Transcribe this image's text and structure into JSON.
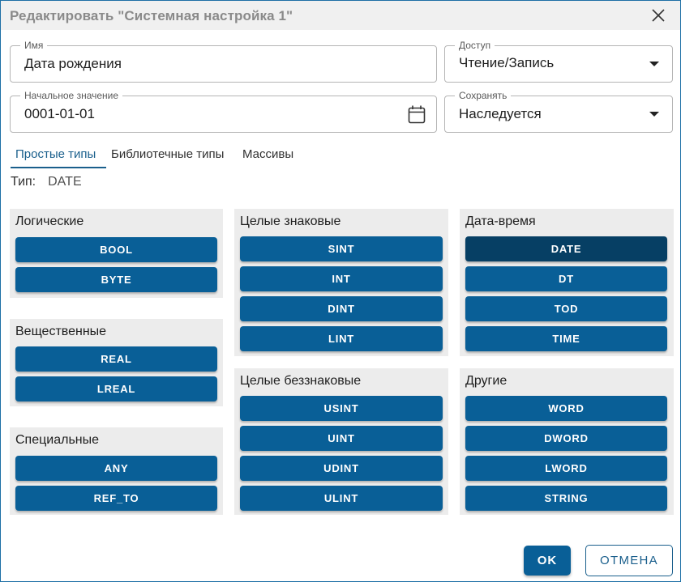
{
  "dialog": {
    "title": "Редактировать \"Системная настройка 1\""
  },
  "fields": {
    "name": {
      "label": "Имя",
      "value": "Дата рождения"
    },
    "access": {
      "label": "Доступ",
      "value": "Чтение/Запись"
    },
    "initial": {
      "label": "Начальное значение",
      "value": "0001-01-01"
    },
    "save": {
      "label": "Сохранять",
      "value": "Наследуется"
    }
  },
  "tabs": [
    "Простые типы",
    "Библиотечные типы",
    "Массивы"
  ],
  "type_line": {
    "label": "Тип:",
    "value": "DATE"
  },
  "groups": {
    "logical": {
      "title": "Логические",
      "items": [
        "BOOL",
        "BYTE"
      ]
    },
    "real": {
      "title": "Вещественные",
      "items": [
        "REAL",
        "LREAL"
      ]
    },
    "special": {
      "title": "Специальные",
      "items": [
        "ANY",
        "REF_TO"
      ]
    },
    "signed": {
      "title": "Целые знаковые",
      "items": [
        "SINT",
        "INT",
        "DINT",
        "LINT"
      ]
    },
    "unsigned": {
      "title": "Целые беззнаковые",
      "items": [
        "USINT",
        "UINT",
        "UDINT",
        "ULINT"
      ]
    },
    "datetime": {
      "title": "Дата-время",
      "items": [
        "DATE",
        "DT",
        "TOD",
        "TIME"
      ]
    },
    "other": {
      "title": "Другие",
      "items": [
        "WORD",
        "DWORD",
        "LWORD",
        "STRING"
      ]
    }
  },
  "selected_type": "DATE",
  "colors": {
    "accent": "#095f97",
    "accent_selected": "#063f64",
    "group_bg": "#ececec"
  },
  "buttons": {
    "ok": "OK",
    "cancel": "ОТМЕНА"
  }
}
